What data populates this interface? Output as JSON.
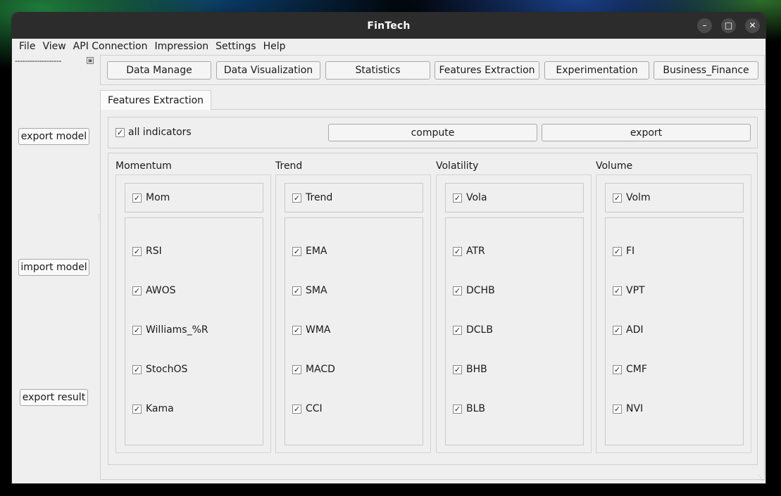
{
  "window": {
    "title": "FinTech"
  },
  "menubar": [
    "File",
    "View",
    "API Connection",
    "Impression",
    "Settings",
    "Help"
  ],
  "sidebar": {
    "dashes": "-------------------",
    "buttons": {
      "export_model": "export model",
      "import_model": "import model",
      "export_result": "export result"
    }
  },
  "toolbar": [
    "Data Manage",
    "Data Visualization",
    "Statistics",
    "Features Extraction",
    "Experimentation",
    "Business_Finance"
  ],
  "tab": {
    "label": "Features Extraction"
  },
  "controls": {
    "all_indicators": "all indicators",
    "all_checked": true,
    "compute": "compute",
    "export": "export"
  },
  "groups": [
    {
      "title": "Momentum",
      "master": "Mom",
      "items": [
        "RSI",
        "AWOS",
        "Williams_%R",
        "StochOS",
        "Kama"
      ]
    },
    {
      "title": "Trend",
      "master": "Trend",
      "items": [
        "EMA",
        "SMA",
        "WMA",
        "MACD",
        "CCI"
      ]
    },
    {
      "title": "Volatility",
      "master": "Vola",
      "items": [
        "ATR",
        "DCHB",
        "DCLB",
        "BHB",
        "BLB"
      ]
    },
    {
      "title": "Volume",
      "master": "Volm",
      "items": [
        "FI",
        "VPT",
        "ADI",
        "CMF",
        "NVI"
      ]
    }
  ]
}
